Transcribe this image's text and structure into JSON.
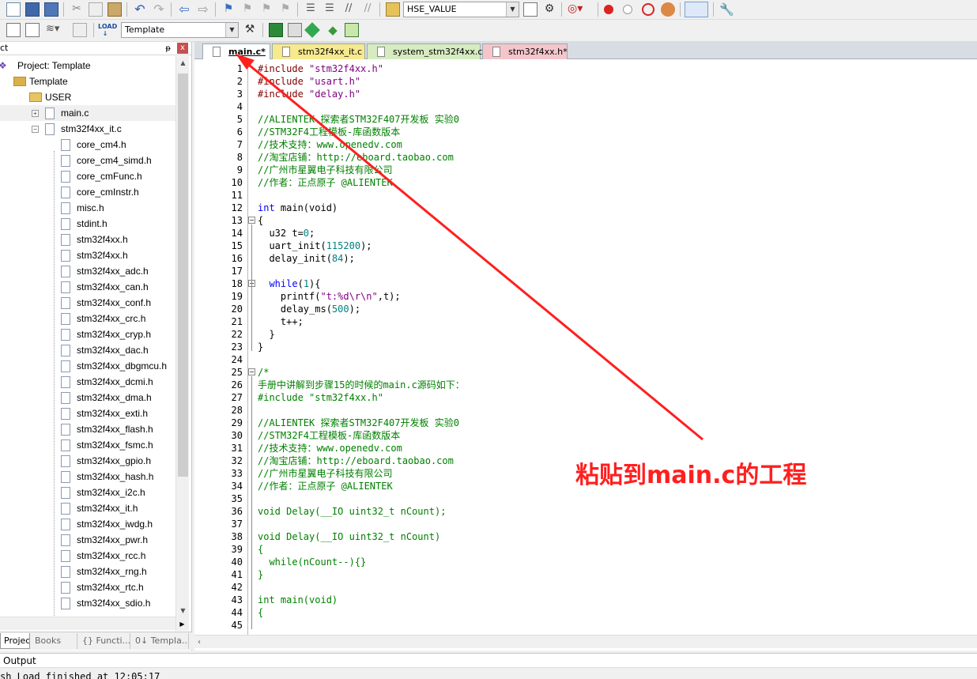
{
  "toolbar1": {
    "define_combo": "HSE_VALUE",
    "icons": [
      "new-file-icon",
      "save-icon",
      "save-all-icon",
      "cut-icon",
      "copy-icon",
      "paste-icon",
      "undo-icon",
      "redo-icon",
      "nav-back-icon",
      "nav-forward-icon",
      "bookmark-icon",
      "prev-bookmark-icon",
      "next-bookmark-icon",
      "clear-bookmarks-icon",
      "indent-icon",
      "unindent-icon",
      "comment-icon",
      "uncomment-icon",
      "find-in-files-icon",
      "find-icon",
      "debug-icon",
      "breakpoint-icon",
      "disable-breakpoint-icon",
      "kill-breakpoints-icon",
      "step-icon",
      "window-layout-icon",
      "configure-icon"
    ]
  },
  "toolbar2": {
    "target_combo": "Template",
    "icons": [
      "compile-icon",
      "build-icon",
      "rebuild-icon",
      "batch-build-icon",
      "download-icon",
      "options-icon",
      "manage-components-icon",
      "pack-installer-icon",
      "select-pack-icon",
      "run-env-icon",
      "manage-env-icon"
    ]
  },
  "left_panel": {
    "title": "ct",
    "pin": "ᵽ",
    "close": "x",
    "tree": [
      {
        "label": "Project: Template",
        "level": 0,
        "kind": "project"
      },
      {
        "label": "Template",
        "level": 1,
        "kind": "target",
        "expanded": true
      },
      {
        "label": "USER",
        "level": 2,
        "kind": "folder",
        "expanded": true
      },
      {
        "label": "main.c",
        "level": 3,
        "kind": "file",
        "expander": "+",
        "selected": true
      },
      {
        "label": "stm32f4xx_it.c",
        "level": 3,
        "kind": "file",
        "expander": "−"
      },
      {
        "label": "core_cm4.h",
        "level": 4,
        "kind": "header"
      },
      {
        "label": "core_cm4_simd.h",
        "level": 4,
        "kind": "header"
      },
      {
        "label": "core_cmFunc.h",
        "level": 4,
        "kind": "header"
      },
      {
        "label": "core_cmInstr.h",
        "level": 4,
        "kind": "header"
      },
      {
        "label": "misc.h",
        "level": 4,
        "kind": "header"
      },
      {
        "label": "stdint.h",
        "level": 4,
        "kind": "header"
      },
      {
        "label": "stm32f4xx.h",
        "level": 4,
        "kind": "header"
      },
      {
        "label": "stm32f4xx.h",
        "level": 4,
        "kind": "header"
      },
      {
        "label": "stm32f4xx_adc.h",
        "level": 4,
        "kind": "header"
      },
      {
        "label": "stm32f4xx_can.h",
        "level": 4,
        "kind": "header"
      },
      {
        "label": "stm32f4xx_conf.h",
        "level": 4,
        "kind": "header"
      },
      {
        "label": "stm32f4xx_crc.h",
        "level": 4,
        "kind": "header"
      },
      {
        "label": "stm32f4xx_cryp.h",
        "level": 4,
        "kind": "header"
      },
      {
        "label": "stm32f4xx_dac.h",
        "level": 4,
        "kind": "header"
      },
      {
        "label": "stm32f4xx_dbgmcu.h",
        "level": 4,
        "kind": "header"
      },
      {
        "label": "stm32f4xx_dcmi.h",
        "level": 4,
        "kind": "header"
      },
      {
        "label": "stm32f4xx_dma.h",
        "level": 4,
        "kind": "header"
      },
      {
        "label": "stm32f4xx_exti.h",
        "level": 4,
        "kind": "header"
      },
      {
        "label": "stm32f4xx_flash.h",
        "level": 4,
        "kind": "header"
      },
      {
        "label": "stm32f4xx_fsmc.h",
        "level": 4,
        "kind": "header"
      },
      {
        "label": "stm32f4xx_gpio.h",
        "level": 4,
        "kind": "header"
      },
      {
        "label": "stm32f4xx_hash.h",
        "level": 4,
        "kind": "header"
      },
      {
        "label": "stm32f4xx_i2c.h",
        "level": 4,
        "kind": "header"
      },
      {
        "label": "stm32f4xx_it.h",
        "level": 4,
        "kind": "header"
      },
      {
        "label": "stm32f4xx_iwdg.h",
        "level": 4,
        "kind": "header"
      },
      {
        "label": "stm32f4xx_pwr.h",
        "level": 4,
        "kind": "header"
      },
      {
        "label": "stm32f4xx_rcc.h",
        "level": 4,
        "kind": "header"
      },
      {
        "label": "stm32f4xx_rng.h",
        "level": 4,
        "kind": "header"
      },
      {
        "label": "stm32f4xx_rtc.h",
        "level": 4,
        "kind": "header"
      },
      {
        "label": "stm32f4xx_sdio.h",
        "level": 4,
        "kind": "header"
      }
    ],
    "tabs": [
      {
        "label": "Project",
        "active": true
      },
      {
        "label": "Books",
        "active": false
      },
      {
        "label": "{} Functi...",
        "active": false
      },
      {
        "label": "0↓ Templa...",
        "active": false
      }
    ]
  },
  "editor": {
    "tabs": [
      {
        "label": "main.c*",
        "active": true,
        "color": "#ffffff"
      },
      {
        "label": "stm32f4xx_it.c",
        "active": false,
        "color": "#f7e98e"
      },
      {
        "label": "system_stm32f4xx.c*",
        "active": false,
        "color": "#d6ecc0"
      },
      {
        "label": "stm32f4xx.h*",
        "active": false,
        "color": "#f4c6cc"
      }
    ],
    "fold_lines": {
      "13": "−",
      "18": "−",
      "25": "−"
    },
    "lines": [
      [
        {
          "t": "#include ",
          "c": "pp"
        },
        {
          "t": "\"stm32f4xx.h\"",
          "c": "st"
        }
      ],
      [
        {
          "t": "#include ",
          "c": "pp"
        },
        {
          "t": "\"usart.h\"",
          "c": "st"
        }
      ],
      [
        {
          "t": "#include ",
          "c": "pp"
        },
        {
          "t": "\"delay.h\"",
          "c": "st"
        }
      ],
      [],
      [
        {
          "t": "//ALIENTEK 探索者STM32F407开发板 实验0",
          "c": "cm"
        }
      ],
      [
        {
          "t": "//STM32F4工程模板-库函数版本",
          "c": "cm"
        }
      ],
      [
        {
          "t": "//技术支持：www.openedv.com",
          "c": "cm"
        }
      ],
      [
        {
          "t": "//淘宝店铺：http://eboard.taobao.com",
          "c": "cm"
        }
      ],
      [
        {
          "t": "//广州市星翼电子科技有限公司",
          "c": "cm"
        }
      ],
      [
        {
          "t": "//作者：正点原子 @ALIENTEK",
          "c": "cm"
        }
      ],
      [],
      [
        {
          "t": "int",
          "c": "kw"
        },
        {
          "t": " main(void)",
          "c": "tx"
        }
      ],
      [
        {
          "t": "{",
          "c": "tx"
        }
      ],
      [
        {
          "t": "  u32 t=",
          "c": "tx"
        },
        {
          "t": "0",
          "c": "nm"
        },
        {
          "t": ";",
          "c": "tx"
        }
      ],
      [
        {
          "t": "  uart_init(",
          "c": "tx"
        },
        {
          "t": "115200",
          "c": "nm"
        },
        {
          "t": ");",
          "c": "tx"
        }
      ],
      [
        {
          "t": "  delay_init(",
          "c": "tx"
        },
        {
          "t": "84",
          "c": "nm"
        },
        {
          "t": ");",
          "c": "tx"
        }
      ],
      [],
      [
        {
          "t": "  ",
          "c": "tx"
        },
        {
          "t": "while",
          "c": "kw"
        },
        {
          "t": "(",
          "c": "tx"
        },
        {
          "t": "1",
          "c": "nm"
        },
        {
          "t": "){",
          "c": "tx"
        }
      ],
      [
        {
          "t": "    printf(",
          "c": "tx"
        },
        {
          "t": "\"t:%d\\r\\n\"",
          "c": "st"
        },
        {
          "t": ",t);",
          "c": "tx"
        }
      ],
      [
        {
          "t": "    delay_ms(",
          "c": "tx"
        },
        {
          "t": "500",
          "c": "nm"
        },
        {
          "t": ");",
          "c": "tx"
        }
      ],
      [
        {
          "t": "    t++;",
          "c": "tx"
        }
      ],
      [
        {
          "t": "  }",
          "c": "tx"
        }
      ],
      [
        {
          "t": "}",
          "c": "tx"
        }
      ],
      [],
      [
        {
          "t": "/*",
          "c": "cm"
        }
      ],
      [
        {
          "t": "手册中讲解到步骤15的时候的main.c源码如下：",
          "c": "cm"
        }
      ],
      [
        {
          "t": "#include \"stm32f4xx.h\"",
          "c": "cm"
        }
      ],
      [],
      [
        {
          "t": "//ALIENTEK 探索者STM32F407开发板 实验0",
          "c": "cm"
        }
      ],
      [
        {
          "t": "//STM32F4工程模板-库函数版本",
          "c": "cm"
        }
      ],
      [
        {
          "t": "//技术支持：www.openedv.com",
          "c": "cm"
        }
      ],
      [
        {
          "t": "//淘宝店铺：http://eboard.taobao.com",
          "c": "cm"
        }
      ],
      [
        {
          "t": "//广州市星翼电子科技有限公司",
          "c": "cm"
        }
      ],
      [
        {
          "t": "//作者：正点原子 @ALIENTEK",
          "c": "cm"
        }
      ],
      [],
      [
        {
          "t": "void Delay(__IO uint32_t nCount);",
          "c": "cm"
        }
      ],
      [],
      [
        {
          "t": "void Delay(__IO uint32_t nCount)",
          "c": "cm"
        }
      ],
      [
        {
          "t": "{",
          "c": "cm"
        }
      ],
      [
        {
          "t": "  while(nCount--){}",
          "c": "cm"
        }
      ],
      [
        {
          "t": "}",
          "c": "cm"
        }
      ],
      [],
      [
        {
          "t": "int main(void)",
          "c": "cm"
        }
      ],
      [
        {
          "t": "{",
          "c": "cm"
        }
      ],
      []
    ]
  },
  "output": {
    "title": "Output",
    "text": "sh Load finished at 12:05:17"
  },
  "annotation": {
    "text": "粘贴到main.c的工程",
    "color": "#ff1f1f"
  }
}
